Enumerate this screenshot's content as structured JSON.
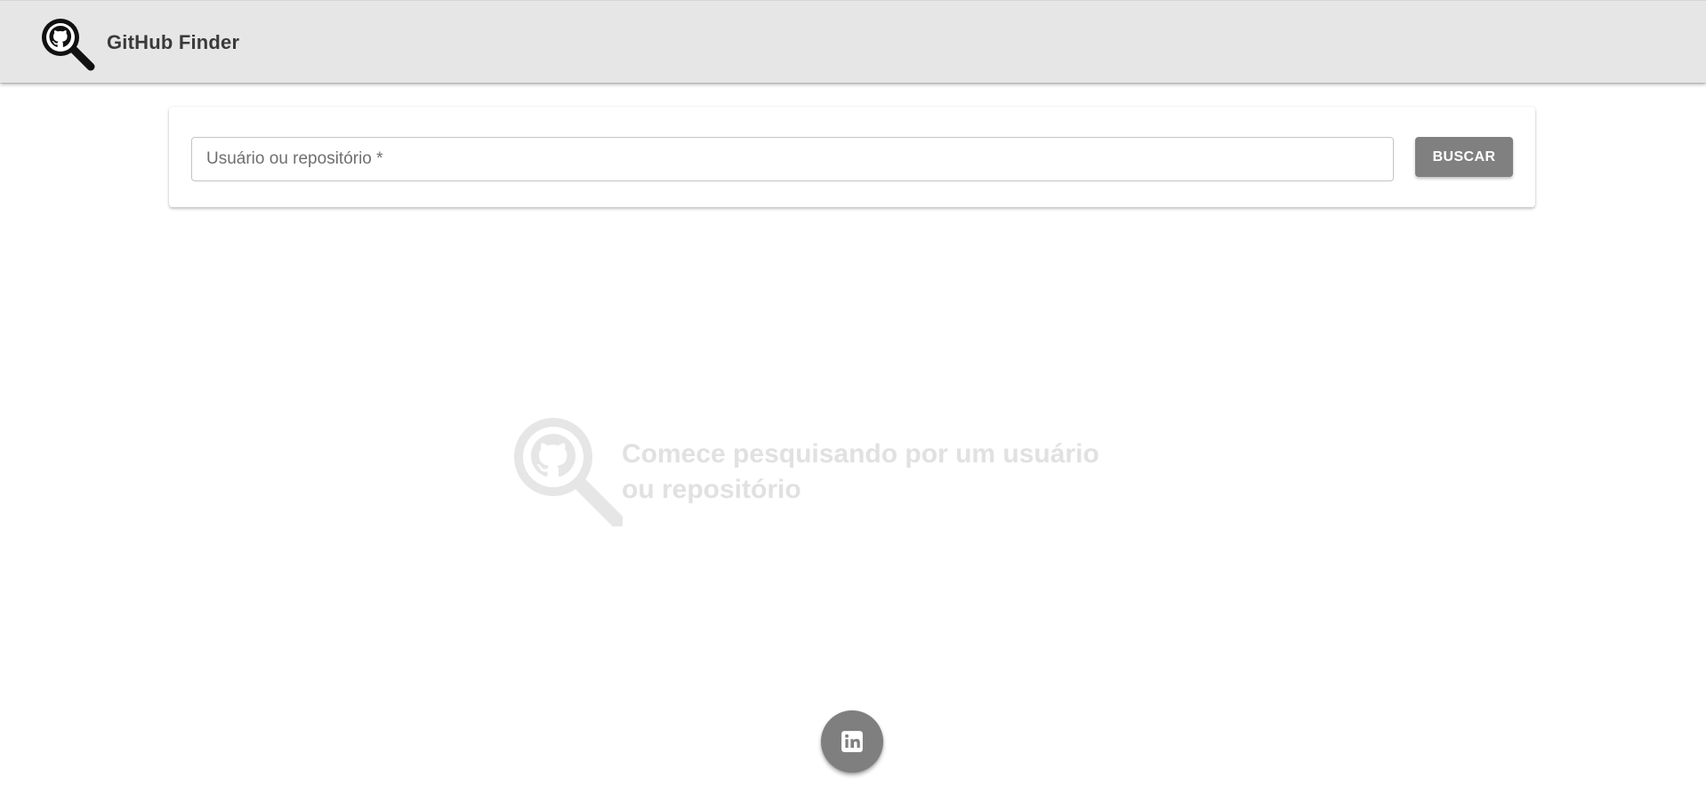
{
  "header": {
    "title": "GitHub Finder",
    "logo_icon": "github-magnifier-icon",
    "background": "#e6e6e6"
  },
  "search": {
    "placeholder": "Usuário ou repositório *",
    "value": "",
    "button_label": "BUSCAR",
    "button_color": "#808080"
  },
  "empty_state": {
    "icon": "github-magnifier-icon",
    "message": "Comece pesquisando por um usuário ou repositório"
  },
  "fab": {
    "icon": "linkedin-icon",
    "color": "#7f7f7f"
  }
}
